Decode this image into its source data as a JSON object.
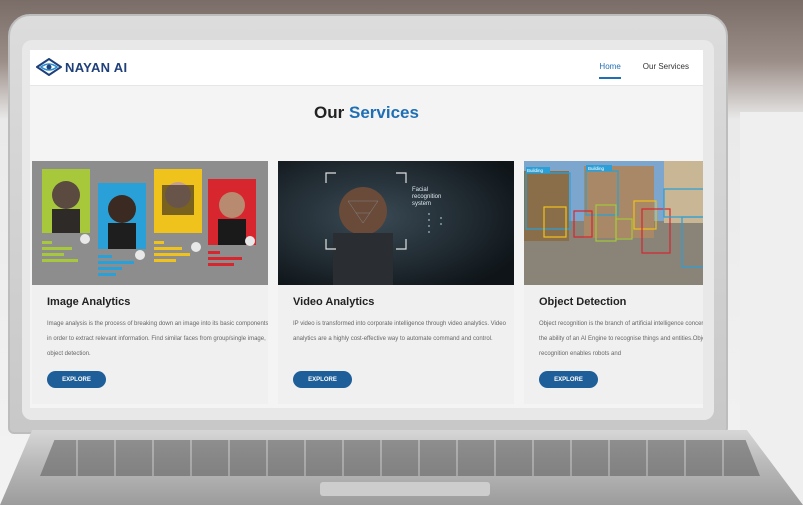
{
  "brand": {
    "name": "NAYAN AI"
  },
  "nav": {
    "items": [
      {
        "label": "Home",
        "active": true
      },
      {
        "label": "Our Services",
        "active": false
      }
    ]
  },
  "section": {
    "title_prefix": "Our",
    "title_accent": "Services"
  },
  "cards": [
    {
      "title": "Image Analytics",
      "description": "Image analysis is the process of breaking down an image into its basic components in order to extract relevant information. Find similar faces from group/single image, object detection.",
      "button": "EXPLORE"
    },
    {
      "title": "Video Analytics",
      "description": "IP video is transformed into corporate intelligence through video analytics. Video analytics are a highly cost-effective way to automate command and control.",
      "button": "EXPLORE",
      "image_text": [
        "Facial",
        "recognition",
        "system"
      ]
    },
    {
      "title": "Object Detection",
      "description": "Object recognition is the branch of artificial intelligence concerned with the ability of an AI Engine to recognise things and entities.Object recognition enables robots and",
      "button": "EXPLORE",
      "image_labels": [
        "Building",
        "Building"
      ]
    }
  ],
  "colors": {
    "accent": "#1f6fb5",
    "button": "#1f5f99",
    "brand": "#1e3f7a"
  }
}
